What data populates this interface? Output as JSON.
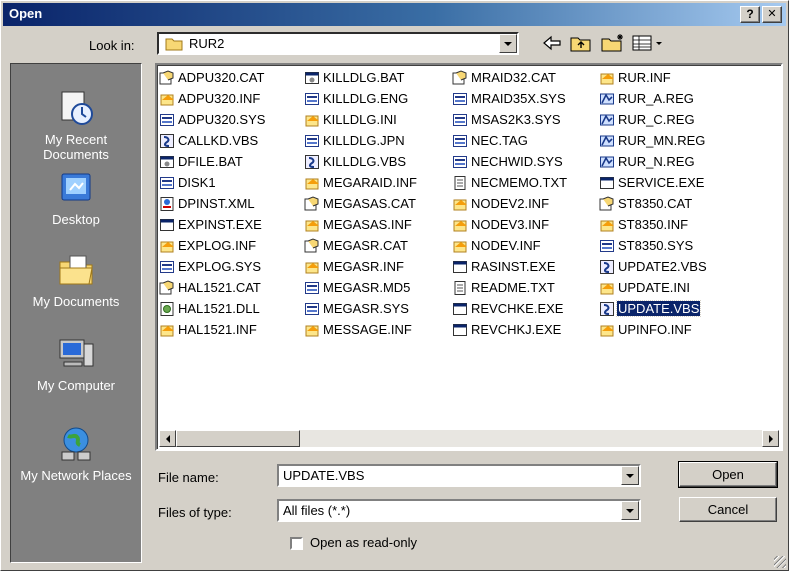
{
  "window": {
    "title": "Open",
    "help_label": "?",
    "close_label": "✕"
  },
  "lookin": {
    "label": "Look in:",
    "value": "RUR2"
  },
  "places": [
    {
      "name": "my-recent-documents",
      "label": "My Recent Documents",
      "icon": "recent-documents-icon"
    },
    {
      "name": "desktop",
      "label": "Desktop",
      "icon": "desktop-icon"
    },
    {
      "name": "my-documents",
      "label": "My Documents",
      "icon": "my-documents-icon"
    },
    {
      "name": "my-computer",
      "label": "My Computer",
      "icon": "my-computer-icon"
    },
    {
      "name": "my-network-places",
      "label": "My Network Places",
      "icon": "network-places-icon"
    }
  ],
  "files": {
    "columns": [
      [
        {
          "name": "ADPU320.CAT",
          "type": "cat"
        },
        {
          "name": "ADPU320.INF",
          "type": "inf"
        },
        {
          "name": "ADPU320.SYS",
          "type": "sys"
        },
        {
          "name": "CALLKD.VBS",
          "type": "vbs"
        },
        {
          "name": "DFILE.BAT",
          "type": "bat"
        },
        {
          "name": "DISK1",
          "type": "sys"
        },
        {
          "name": "DPINST.XML",
          "type": "xml"
        },
        {
          "name": "EXPINST.EXE",
          "type": "exe"
        },
        {
          "name": "EXPLOG.INF",
          "type": "inf"
        },
        {
          "name": "EXPLOG.SYS",
          "type": "sys"
        },
        {
          "name": "HAL1521.CAT",
          "type": "cat"
        },
        {
          "name": "HAL1521.DLL",
          "type": "dll"
        },
        {
          "name": "HAL1521.INF",
          "type": "inf"
        }
      ],
      [
        {
          "name": "KILLDLG.BAT",
          "type": "bat"
        },
        {
          "name": "KILLDLG.ENG",
          "type": "sys"
        },
        {
          "name": "KILLDLG.INI",
          "type": "inf"
        },
        {
          "name": "KILLDLG.JPN",
          "type": "sys"
        },
        {
          "name": "KILLDLG.VBS",
          "type": "vbs"
        },
        {
          "name": "MEGARAID.INF",
          "type": "inf"
        },
        {
          "name": "MEGASAS.CAT",
          "type": "cat"
        },
        {
          "name": "MEGASAS.INF",
          "type": "inf"
        },
        {
          "name": "MEGASR.CAT",
          "type": "cat"
        },
        {
          "name": "MEGASR.INF",
          "type": "inf"
        },
        {
          "name": "MEGASR.MD5",
          "type": "sys"
        },
        {
          "name": "MEGASR.SYS",
          "type": "sys"
        },
        {
          "name": "MESSAGE.INF",
          "type": "inf"
        }
      ],
      [
        {
          "name": "MRAID32.CAT",
          "type": "cat"
        },
        {
          "name": "MRAID35X.SYS",
          "type": "sys"
        },
        {
          "name": "MSAS2K3.SYS",
          "type": "sys"
        },
        {
          "name": "NEC.TAG",
          "type": "sys"
        },
        {
          "name": "NECHWID.SYS",
          "type": "sys"
        },
        {
          "name": "NECMEMO.TXT",
          "type": "txt"
        },
        {
          "name": "NODEV2.INF",
          "type": "inf"
        },
        {
          "name": "NODEV3.INF",
          "type": "inf"
        },
        {
          "name": "NODEV.INF",
          "type": "inf"
        },
        {
          "name": "RASINST.EXE",
          "type": "exe"
        },
        {
          "name": "README.TXT",
          "type": "txt"
        },
        {
          "name": "REVCHKE.EXE",
          "type": "exe"
        },
        {
          "name": "REVCHKJ.EXE",
          "type": "exe"
        }
      ],
      [
        {
          "name": "RUR.INF",
          "type": "inf"
        },
        {
          "name": "RUR_A.REG",
          "type": "reg"
        },
        {
          "name": "RUR_C.REG",
          "type": "reg"
        },
        {
          "name": "RUR_MN.REG",
          "type": "reg"
        },
        {
          "name": "RUR_N.REG",
          "type": "reg"
        },
        {
          "name": "SERVICE.EXE",
          "type": "exe"
        },
        {
          "name": "ST8350.CAT",
          "type": "cat"
        },
        {
          "name": "ST8350.INF",
          "type": "inf"
        },
        {
          "name": "ST8350.SYS",
          "type": "sys"
        },
        {
          "name": "UPDATE2.VBS",
          "type": "vbs"
        },
        {
          "name": "UPDATE.INI",
          "type": "inf"
        },
        {
          "name": "UPDATE.VBS",
          "type": "vbs",
          "selected": true
        },
        {
          "name": "UPINFO.INF",
          "type": "inf"
        }
      ]
    ]
  },
  "filename": {
    "label": "File name:",
    "value": "UPDATE.VBS"
  },
  "filetype": {
    "label": "Files of type:",
    "value": "All files (*.*)"
  },
  "readonly": {
    "label": "Open as read-only",
    "checked": false
  },
  "buttons": {
    "open": "Open",
    "cancel": "Cancel"
  }
}
